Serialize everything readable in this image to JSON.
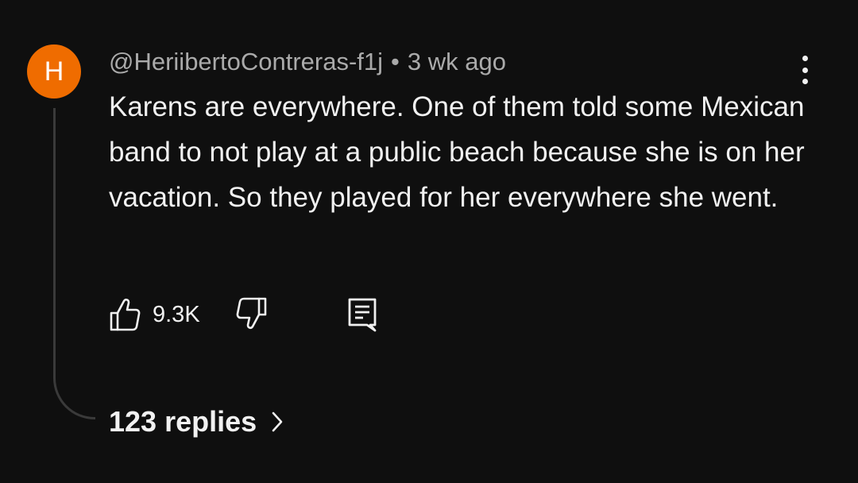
{
  "comment": {
    "avatar_letter": "H",
    "avatar_color": "#ef6c00",
    "author": "@HeriibertoContreras-f1j",
    "separator": "•",
    "time": "3 wk ago",
    "text": "Karens are everywhere. One of them told some Mexican band to not play at a public beach because she is on her vacation. So they played for her everywhere she went.",
    "like_count": "9.3K",
    "replies_label": "123 replies"
  },
  "icons": {
    "more": "more-vertical-icon",
    "like": "thumbs-up-icon",
    "dislike": "thumbs-down-icon",
    "reply": "comment-icon",
    "chevron": "chevron-right-icon"
  },
  "colors": {
    "background": "#0f0f0f",
    "text": "#f1f1f1",
    "meta_text": "#aaaaaa",
    "thread_line": "#3a3a3a"
  }
}
